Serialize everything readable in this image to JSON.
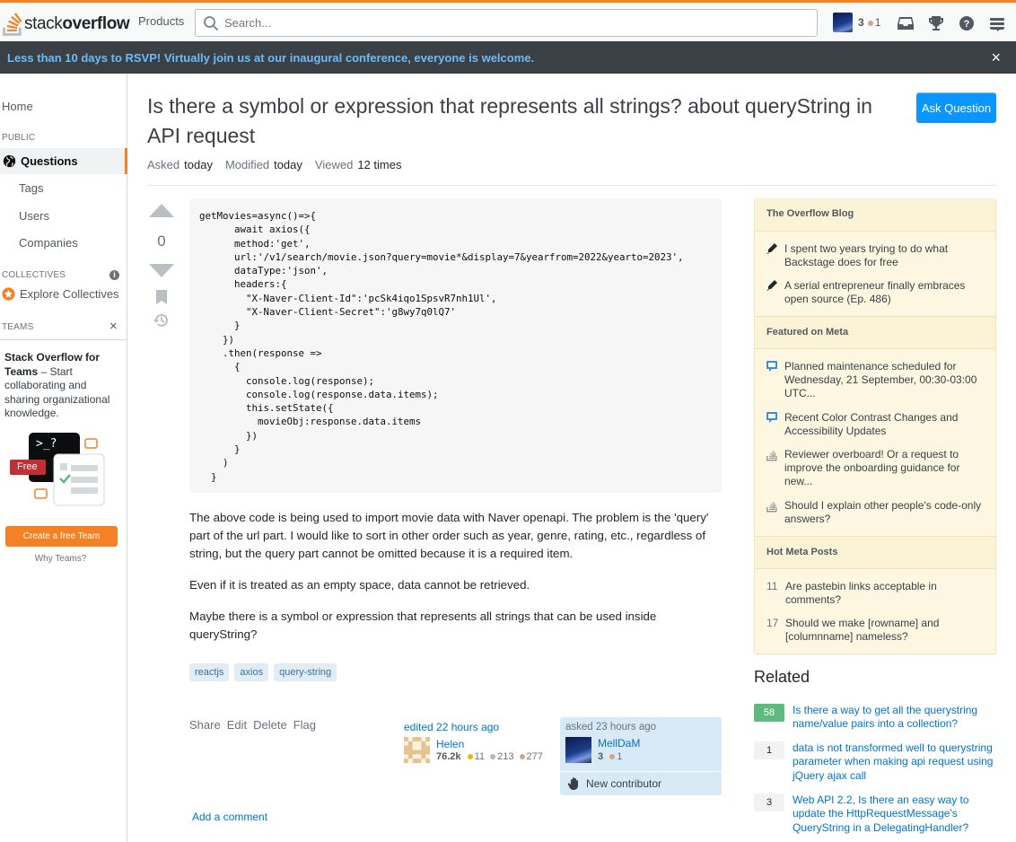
{
  "topbar": {
    "logo_prefix": "stack",
    "logo_suffix": "overflow",
    "products": "Products",
    "search_placeholder": "Search...",
    "user_rep": "3",
    "user_bronze": "1"
  },
  "banner": {
    "text": "Less than 10 days to RSVP! Virtually join us at our inaugural conference, everyone is welcome.",
    "close": "×"
  },
  "sidebar": {
    "home": "Home",
    "public_label": "PUBLIC",
    "questions": "Questions",
    "tags": "Tags",
    "users": "Users",
    "companies": "Companies",
    "collectives_label": "COLLECTIVES",
    "info": "i",
    "explore": "Explore Collectives",
    "teams_label": "TEAMS",
    "teams_close": "×",
    "teams_bold": "Stack Overflow for Teams",
    "teams_text": " – Start collaborating and sharing organizational knowledge.",
    "free_badge": "Free",
    "prompt": ">_?",
    "create_team": "Create a free Team",
    "why_teams": "Why Teams?"
  },
  "question": {
    "title": "Is there a symbol or expression that represents all strings? about queryString in API request",
    "ask_button": "Ask Question",
    "asked_label": "Asked",
    "asked_value": "today",
    "modified_label": "Modified",
    "modified_value": "today",
    "viewed_label": "Viewed",
    "viewed_value": "12 times",
    "votes": "0",
    "paragraphs": [
      "The above code is being used to import movie data with Naver openapi. The problem is the 'query' part of the url part. I would like to sort in other order such as year, genre, rating, etc., regardless of string, but the query part cannot be omitted because it is a required item.",
      "Even if it is treated as an empty space, data cannot be retrieved.",
      "Maybe there is a symbol or expression that represents all strings that can be used inside queryString?"
    ],
    "tags": [
      "reactjs",
      "axios",
      "query-string"
    ],
    "menu": [
      "Share",
      "Edit",
      "Delete",
      "Flag"
    ],
    "edited_label": "edited 22 hours ago",
    "editor_name": "Helen",
    "editor_rep": "76.2k",
    "editor_gold": "11",
    "editor_silver": "213",
    "editor_bronze": "277",
    "asked_card_label": "asked 23 hours ago",
    "asker_name": "MellDaM",
    "asker_rep": "3",
    "asker_bronze": "1",
    "new_contributor": "New contributor",
    "add_comment": "Add a comment"
  },
  "code_lines": [
    "getMovies=async()=>{",
    "      await axios({",
    "      method:'get',",
    "      url:'/v1/search/movie.json?query=movie*&display=7&yearfrom=2022&yearto=2023',",
    "      dataType:'json',",
    "      headers:{",
    "        \"X-Naver-Client-Id\":'pcSk4iqo1SpsvR7nh1Ul',",
    "        \"X-Naver-Client-Secret\":'g8wy7q0lQ7'",
    "      }",
    "    })",
    "    .then(response =>",
    "      {",
    "        console.log(response);",
    "        console.log(response.data.items);",
    "        this.setState({",
    "          movieObj:response.data.items",
    "        })",
    "      }",
    "    )",
    "  }"
  ],
  "overflow_blog": {
    "heading": "The Overflow Blog",
    "items": [
      "I spent two years trying to do what Backstage does for free",
      "A serial entrepreneur finally embraces open source (Ep. 486)"
    ]
  },
  "featured_meta": {
    "heading": "Featured on Meta",
    "items": [
      "Planned maintenance scheduled for Wednesday, 21 September, 00:30-03:00 UTC...",
      "Recent Color Contrast Changes and Accessibility Updates",
      "Reviewer overboard! Or a request to improve the onboarding guidance for new...",
      "Should I explain other people's code-only answers?"
    ]
  },
  "hot_meta": {
    "heading": "Hot Meta Posts",
    "items": [
      {
        "count": "11",
        "title": "Are pastebin links acceptable in comments?"
      },
      {
        "count": "17",
        "title": "Should we make [rowname] and [columnname] nameless?"
      }
    ]
  },
  "related": {
    "heading": "Related",
    "items": [
      {
        "count": "58",
        "title": "Is there a way to get all the querystring name/value pairs into a collection?"
      },
      {
        "count": "1",
        "title": "data is not transformed well to querystring parameter when making api request using jQuery ajax call"
      },
      {
        "count": "3",
        "title": "Web API 2.2, Is there an easy way to update the HttpRequestMessage's QueryString in a DelegatingHandler?"
      }
    ]
  },
  "colors": {
    "accent": "#f48225",
    "link": "#0074cc",
    "ask_button": "#0a95ff",
    "banner_bg": "#3b4045",
    "banner_text": "#6cbbf7",
    "answered": "#5eba7d",
    "gold": "#f1b600",
    "silver": "#b4b8bc",
    "bronze": "#d1a684"
  }
}
